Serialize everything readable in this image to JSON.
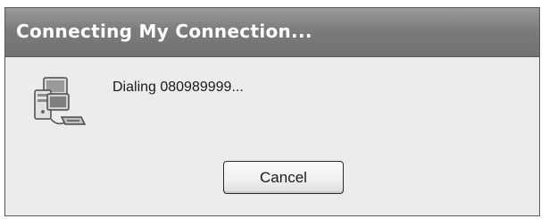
{
  "window": {
    "title": "Connecting My Connection..."
  },
  "content": {
    "icon": "network-connection-icon",
    "message": "Dialing 080989999..."
  },
  "buttons": {
    "cancel_label": "Cancel"
  },
  "colors": {
    "titlebar": "#7c7c7c",
    "dialog_background": "#ececec",
    "title_text": "#ffffff"
  }
}
